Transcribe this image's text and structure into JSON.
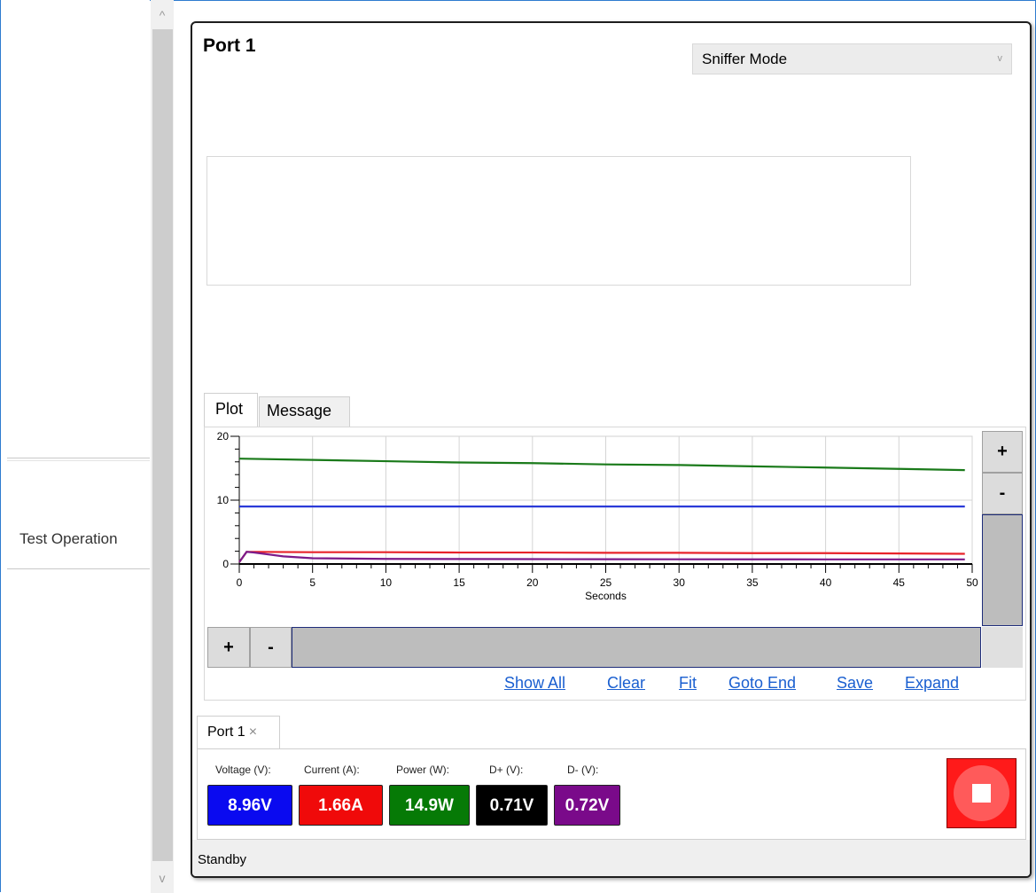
{
  "sidebar": {
    "test_operation_label": "Test Operation"
  },
  "scrollbar": {
    "up_arrow": "^",
    "down_arrow": "v"
  },
  "port_panel": {
    "title": "Port 1",
    "mode_select": {
      "value": "Sniffer Mode",
      "chevron": "v"
    }
  },
  "tabs": {
    "plot": "Plot",
    "message": "Message"
  },
  "chart_data": {
    "type": "line",
    "xlabel": "Seconds",
    "ylabel": "",
    "xlim": [
      0,
      50
    ],
    "ylim": [
      0,
      20
    ],
    "x_ticks": [
      "0",
      "5",
      "10",
      "15",
      "20",
      "25",
      "30",
      "35",
      "40",
      "45",
      "50"
    ],
    "y_ticks": [
      "0",
      "10",
      "20"
    ],
    "grid": true,
    "series": [
      {
        "color": "#1a7a1a",
        "x": [
          0,
          5,
          10,
          15,
          20,
          25,
          30,
          35,
          40,
          45,
          49.5
        ],
        "values": [
          16.5,
          16.3,
          16.1,
          15.9,
          15.8,
          15.6,
          15.5,
          15.3,
          15.1,
          14.9,
          14.7
        ]
      },
      {
        "color": "#1f2fd6",
        "x": [
          0,
          5,
          10,
          15,
          20,
          25,
          30,
          35,
          40,
          45,
          49.5
        ],
        "values": [
          9.0,
          9.0,
          9.0,
          9.0,
          9.0,
          9.0,
          9.0,
          9.0,
          9.0,
          9.0,
          9.0
        ]
      },
      {
        "color": "#e8232a",
        "x": [
          0,
          0.5,
          1,
          5,
          10,
          15,
          20,
          25,
          30,
          35,
          40,
          45,
          49.5
        ],
        "values": [
          0.3,
          1.9,
          1.9,
          1.85,
          1.85,
          1.8,
          1.8,
          1.75,
          1.75,
          1.7,
          1.7,
          1.65,
          1.6
        ]
      },
      {
        "color": "#7b1a8a",
        "x": [
          0,
          0.5,
          1,
          3,
          5,
          10,
          15,
          20,
          25,
          30,
          35,
          40,
          45,
          49.5
        ],
        "values": [
          0.3,
          1.9,
          1.8,
          1.2,
          0.9,
          0.8,
          0.78,
          0.76,
          0.75,
          0.74,
          0.73,
          0.72,
          0.72,
          0.72
        ]
      }
    ]
  },
  "plot_controls": {
    "y_zoom_in": "+",
    "y_zoom_out": "-",
    "x_zoom_in": "+",
    "x_zoom_out": "-"
  },
  "links": {
    "show_all": "Show All",
    "clear": "Clear",
    "fit": "Fit",
    "goto_end": "Goto End",
    "save": "Save",
    "expand": "Expand"
  },
  "port_tab": {
    "label": "Port 1",
    "close": "×"
  },
  "meters": {
    "voltage": {
      "label": "Voltage (V):",
      "value": "8.96V",
      "color": "#0a0af0"
    },
    "current": {
      "label": "Current (A):",
      "value": "1.66A",
      "color": "#f00a0a"
    },
    "power": {
      "label": "Power (W):",
      "value": "14.9W",
      "color": "#067a06"
    },
    "dplus": {
      "label": "D+ (V):",
      "value": "0.71V",
      "color": "#000000"
    },
    "dminus": {
      "label": "D- (V):",
      "value": "0.72V",
      "color": "#7a0a8a"
    }
  },
  "status": {
    "text": "Standby"
  }
}
